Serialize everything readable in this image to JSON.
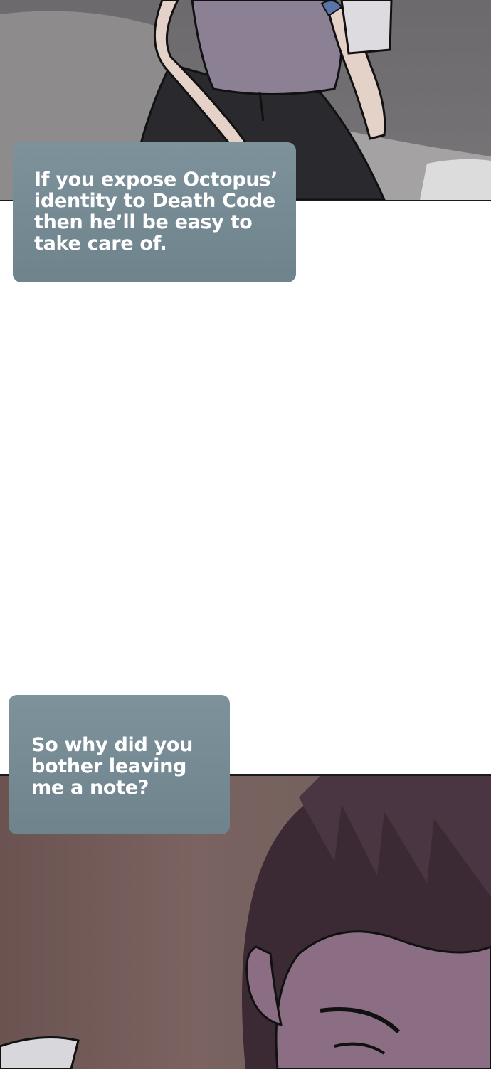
{
  "page": {
    "background": "#ffffff"
  },
  "panels": {
    "top": {
      "description_colors": {
        "background": "#6c6a6d",
        "shirt": "#8c8094",
        "pants": "#2a2a2e",
        "skin": "#e4d2c8",
        "border": "#1b1b1b"
      }
    },
    "bottom": {
      "description_colors": {
        "wall": "#6a5350",
        "hair": "#3b2a34",
        "skin": "#8b6e84",
        "border": "#1b1b1b"
      }
    }
  },
  "speech_bubbles": [
    {
      "lines": [
        "If you expose Octopus’",
        "identity to Death Code",
        "then he’ll be easy to",
        "take care of."
      ],
      "color": "#7a8e98"
    },
    {
      "lines": [
        "So why did you",
        "bother leaving",
        "me a note?"
      ],
      "color": "#7a8e98"
    }
  ]
}
